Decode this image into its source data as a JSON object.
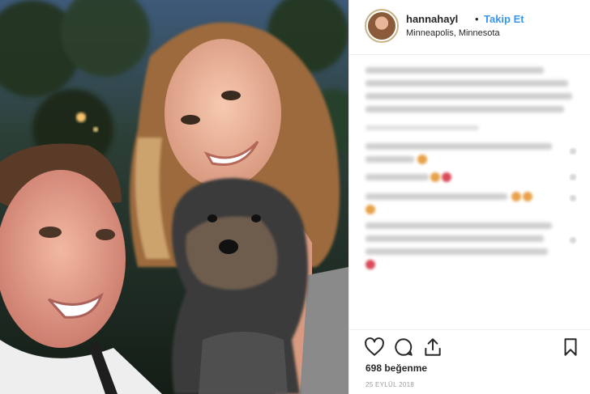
{
  "post": {
    "username": "hannahayl",
    "separator": "•",
    "follow_label": "Takip Et",
    "location": "Minneapolis, Minnesota",
    "likes_text": "698 beğenme",
    "date_text": "25 EYLÜL 2018"
  },
  "icons": {
    "like": "heart-icon",
    "comment": "comment-icon",
    "share": "share-icon",
    "save": "bookmark-icon"
  },
  "colors": {
    "accent": "#3897f0",
    "text": "#262626",
    "muted": "#999999",
    "border": "#efefef"
  }
}
